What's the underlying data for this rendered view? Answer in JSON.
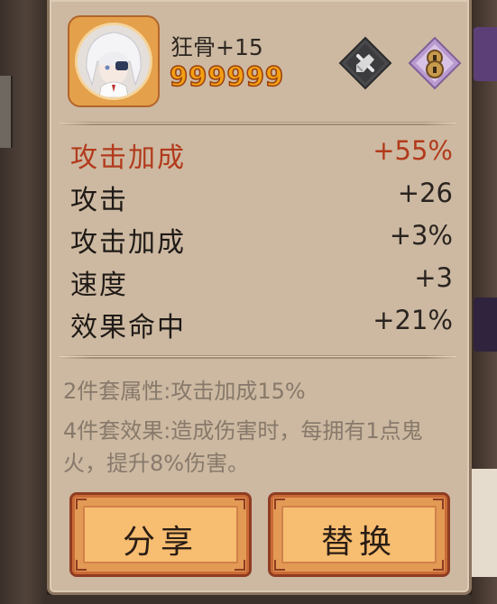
{
  "soul": {
    "name": "狂骨+15",
    "score": "999999",
    "slot_icons": [
      "brush-icon",
      "seal-icon"
    ]
  },
  "stats": [
    {
      "label": "攻击加成",
      "value": "+55%",
      "primary": true
    },
    {
      "label": "攻击",
      "value": "+26"
    },
    {
      "label": "攻击加成",
      "value": "+3%"
    },
    {
      "label": "速度",
      "value": "+3"
    },
    {
      "label": "效果命中",
      "value": "+21%"
    }
  ],
  "set_bonus": {
    "two_piece": "2件套属性:攻击加成15%",
    "four_piece": "4件套效果:造成伤害时，每拥有1点鬼火，提升8%伤害。"
  },
  "buttons": {
    "share_label": "分享",
    "replace_label": "替换"
  },
  "colors": {
    "primary_stat": "#b23a1c",
    "panel_bg": "#cdb9a1",
    "button_bg": "#f7bd70",
    "score_fill": "#f2a012"
  }
}
